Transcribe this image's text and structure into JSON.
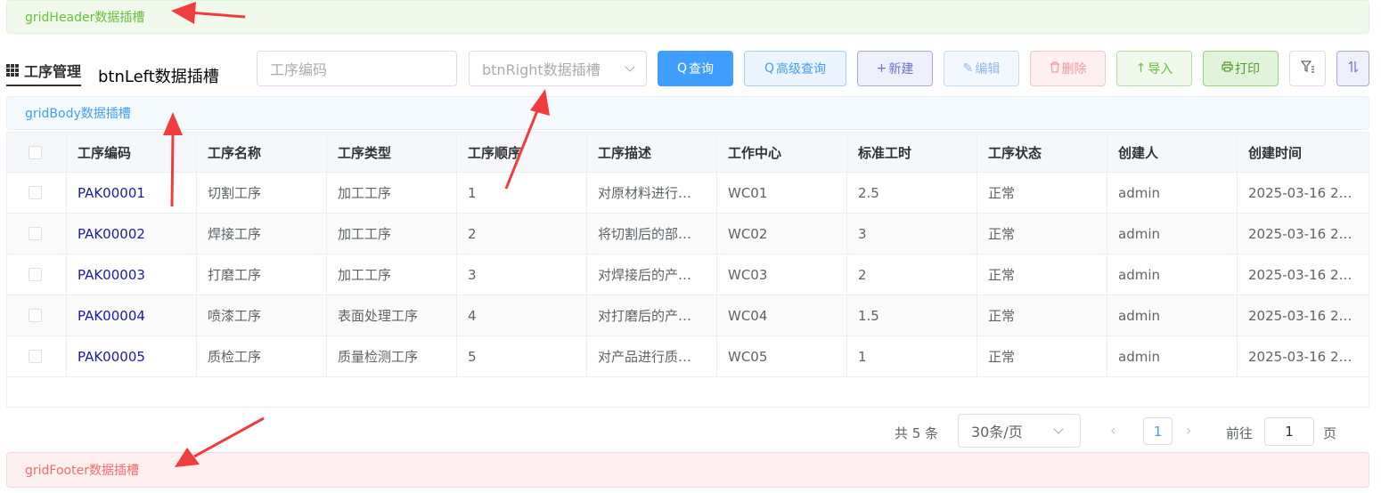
{
  "slots": {
    "header": "gridHeader数据插槽",
    "body": "gridBody数据插槽",
    "footer": "gridFooter数据插槽"
  },
  "toolbar": {
    "title": "工序管理",
    "btn_left": "btnLeft数据插槽",
    "code_placeholder": "工序编码",
    "right_select": "btnRight数据插槽",
    "buttons": {
      "query": "查询",
      "advanced": "高级查询",
      "new": "新建",
      "edit": "编辑",
      "delete": "删除",
      "import": "导入",
      "print": "打印"
    }
  },
  "table": {
    "columns": [
      "工序编码",
      "工序名称",
      "工序类型",
      "工序顺序",
      "工序描述",
      "工作中心",
      "标准工时",
      "工序状态",
      "创建人",
      "创建时间"
    ],
    "rows": [
      [
        "PAK00001",
        "切割工序",
        "加工工序",
        "1",
        "对原材料进行…",
        "WC01",
        "2.5",
        "正常",
        "admin",
        "2025-03-16 2…"
      ],
      [
        "PAK00002",
        "焊接工序",
        "加工工序",
        "2",
        "将切割后的部…",
        "WC02",
        "3",
        "正常",
        "admin",
        "2025-03-16 2…"
      ],
      [
        "PAK00003",
        "打磨工序",
        "加工工序",
        "3",
        "对焊接后的产…",
        "WC03",
        "2",
        "正常",
        "admin",
        "2025-03-16 2…"
      ],
      [
        "PAK00004",
        "喷漆工序",
        "表面处理工序",
        "4",
        "对打磨后的产…",
        "WC04",
        "1.5",
        "正常",
        "admin",
        "2025-03-16 2…"
      ],
      [
        "PAK00005",
        "质检工序",
        "质量检测工序",
        "5",
        "对产品进行质…",
        "WC05",
        "1",
        "正常",
        "admin",
        "2025-03-16 2…"
      ]
    ]
  },
  "pagination": {
    "total": "共 5 条",
    "page_size": "30条/页",
    "current_page": "1",
    "goto_label": "前往",
    "goto_value": "1",
    "page_unit": "页",
    "prev": "‹",
    "next": "›"
  },
  "colors": {
    "primary": "#409eff",
    "success": "#67c23a",
    "danger": "#f56c6c",
    "annotation_arrow": "#f03c3c",
    "link": "#1a1aa6"
  }
}
